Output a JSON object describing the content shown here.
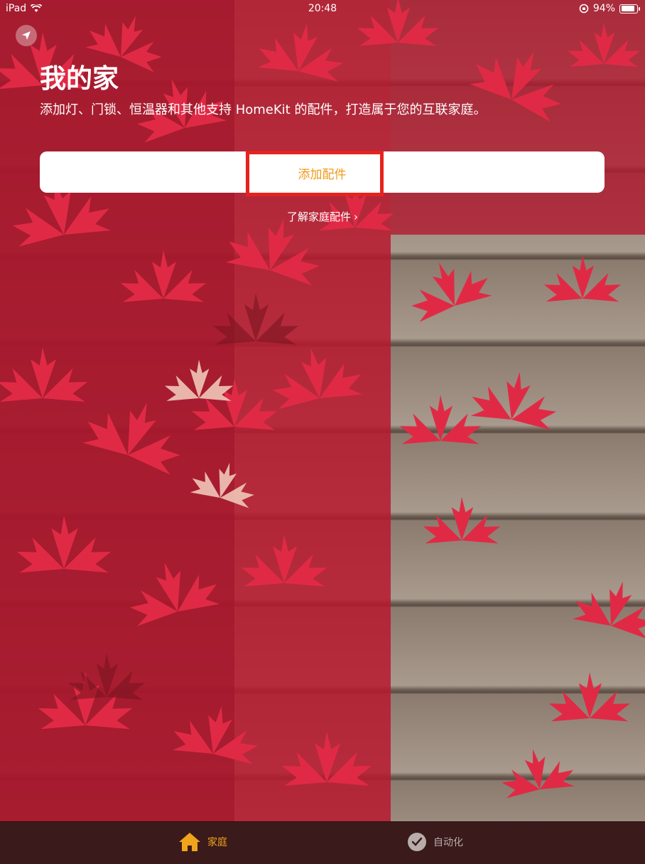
{
  "status_bar": {
    "device": "iPad",
    "time": "20:48",
    "battery": "94%"
  },
  "header": {
    "title": "我的家",
    "subtitle": "添加灯、门锁、恒温器和其他支持 HomeKit 的配件，打造属于您的互联家庭。"
  },
  "actions": {
    "add_accessory": "添加配件",
    "learn_more": "了解家庭配件"
  },
  "tab_bar": {
    "tabs": [
      {
        "label": "家庭",
        "icon": "house-icon",
        "selected": true
      },
      {
        "label": "自动化",
        "icon": "clock-icon",
        "selected": false
      }
    ]
  },
  "colors": {
    "accent": "#f09a1a",
    "highlight_border": "#e6231e",
    "tab_inactive": "#b8adab"
  }
}
